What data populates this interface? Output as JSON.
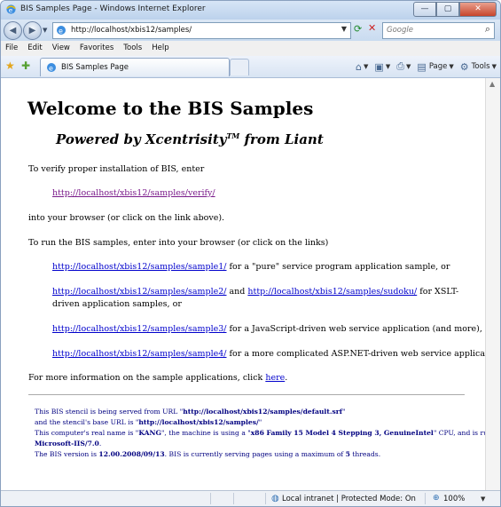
{
  "window": {
    "title": "BIS Samples Page - Windows Internet Explorer",
    "min_icon": "—",
    "max_icon": "▢",
    "close_icon": "✕"
  },
  "address": {
    "url": "http://localhost/xbis12/samples/",
    "search_placeholder": "Google"
  },
  "menu": [
    "File",
    "Edit",
    "View",
    "Favorites",
    "Tools",
    "Help"
  ],
  "tab": {
    "label": "BIS Samples Page"
  },
  "commands": {
    "page_label": "Page",
    "tools_label": "Tools"
  },
  "content": {
    "heading": "Welcome to the BIS Samples",
    "subheading_pre": "Powered by Xcentrisity",
    "subheading_tm": "TM",
    "subheading_post": " from Liant",
    "verify_intro": "To verify proper installation of BIS, enter",
    "verify_link": "http://localhost/xbis12/samples/verify/",
    "verify_after": "into your browser (or click on the link above).",
    "run_intro": "To run the BIS samples, enter into your browser (or click on the links)",
    "sample1_link": "http://localhost/xbis12/samples/sample1/",
    "sample1_desc": " for a \"pure\" service program application sample, or",
    "sample2_link": "http://localhost/xbis12/samples/sample2/",
    "sample2_and": " and ",
    "sudoku_link": "http://localhost/xbis12/samples/sudoku/",
    "sample2_desc": " for XSLT-driven application samples, or",
    "sample3_link": "http://localhost/xbis12/samples/sample3/",
    "sample3_desc": " for a JavaScript-driven web service application (and more), or",
    "sample4_link": "http://localhost/xbis12/samples/sample4/",
    "sample4_desc": " for a more complicated ASP.NET-driven web service application.",
    "more_info_pre": "For more information on the sample applications, click ",
    "more_info_link": "here",
    "more_info_post": "."
  },
  "footer_note": {
    "line1_pre": "This BIS stencil is being served from URL \"",
    "line1_url": "http://localhost/xbis12/samples/default.srf",
    "line1_post": "\"",
    "line2_pre": "and the stencil's base URL is \"",
    "line2_url": "http://localhost/xbis12/samples/",
    "line2_post": "\"",
    "line3_pre": "This computer's real name is \"",
    "line3_name": "KANG",
    "line3_mid": "\", the machine is using a \"",
    "line3_cpu": "x86 Family 15 Model 4 Stepping 3, GenuineIntel",
    "line3_post": "\" CPU, and is running",
    "line4_server": "Microsoft-IIS/7.0",
    "line4_post": ".",
    "line5_pre": "The BIS version is ",
    "line5_version": "12.00.2008/09/13",
    "line5_mid": ". BIS is currently serving pages using a maximum of ",
    "line5_threads": "5",
    "line5_post": " threads."
  },
  "status": {
    "zone": "Local intranet | Protected Mode: On",
    "zoom": "100%"
  }
}
